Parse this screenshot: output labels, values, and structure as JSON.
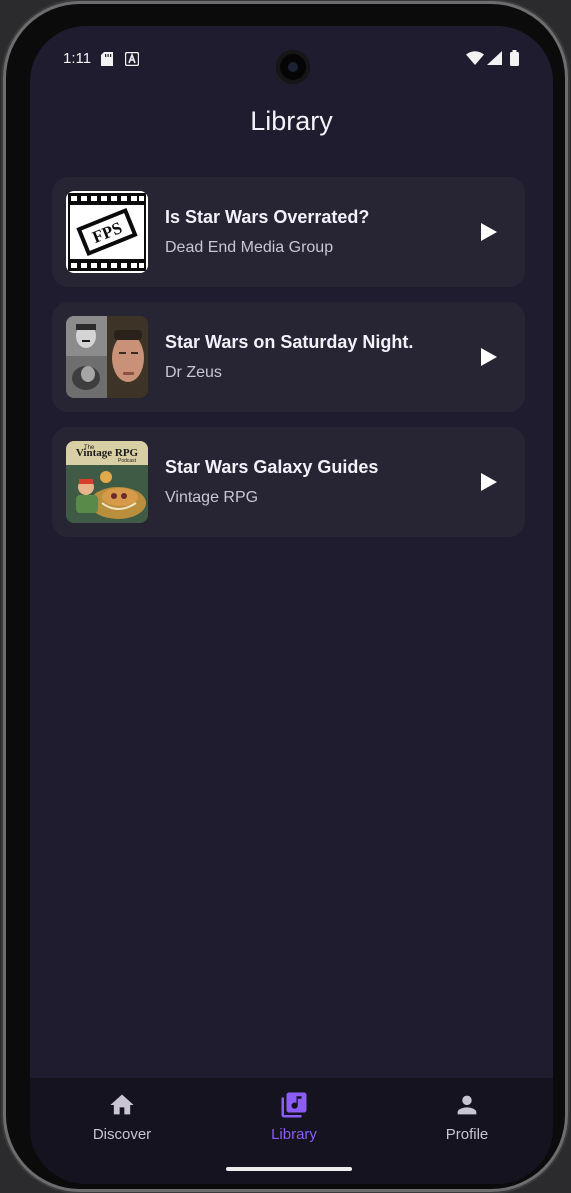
{
  "status_bar": {
    "time": "1:11",
    "icons": [
      "sd-card-icon",
      "accessibility-notification-icon",
      "wifi-icon",
      "signal-icon",
      "battery-icon"
    ]
  },
  "header": {
    "title": "Library"
  },
  "library": {
    "items": [
      {
        "title": "Is Star Wars Overrated?",
        "author": "Dead End Media Group",
        "thumbnail": "fps-podcast-cover"
      },
      {
        "title": "Star Wars on Saturday Night.",
        "author": "Dr Zeus",
        "thumbnail": "dr-zeus-cover"
      },
      {
        "title": "Star Wars Galaxy Guides",
        "author": "Vintage RPG",
        "thumbnail": "vintage-rpg-cover",
        "cover_text": "Vintage RPG",
        "cover_sub": "The",
        "cover_sub2": "Podcast"
      }
    ]
  },
  "bottom_nav": {
    "items": [
      {
        "label": "Discover",
        "icon": "home-icon",
        "active": false
      },
      {
        "label": "Library",
        "icon": "library-music-icon",
        "active": true
      },
      {
        "label": "Profile",
        "icon": "person-icon",
        "active": false
      }
    ]
  },
  "colors": {
    "background": "#1e1c2e",
    "card": "#272434",
    "accent": "#8b5cf6",
    "nav_background": "#151320"
  }
}
